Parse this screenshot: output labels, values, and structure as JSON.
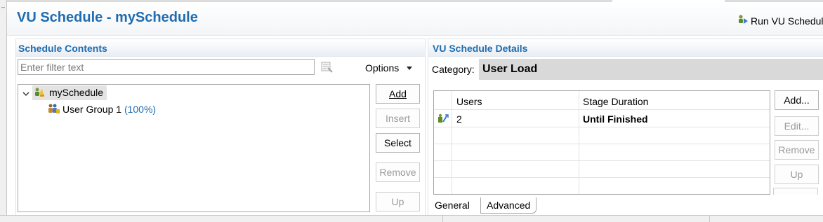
{
  "editor": {
    "title": "VU Schedule - mySchedule",
    "run_label": "Run VU Schedul"
  },
  "schedule_contents": {
    "header": "Schedule Contents",
    "filter_placeholder": "Enter filter text",
    "options_label": "Options",
    "tree": {
      "root_label": "mySchedule",
      "child_label": "User Group 1",
      "child_percent": "(100%)"
    },
    "buttons": {
      "add": "Add",
      "insert": "Insert",
      "select": "Select",
      "remove": "Remove",
      "up": "Up"
    }
  },
  "vu_details": {
    "header": "VU Schedule Details",
    "category_label": "Category:",
    "category_value": "User Load",
    "table": {
      "columns": [
        "Users",
        "Stage Duration"
      ],
      "rows": [
        {
          "users": "2",
          "stage_duration": "Until Finished"
        }
      ]
    },
    "buttons": {
      "add": "Add...",
      "edit": "Edit...",
      "remove": "Remove",
      "up": "Up"
    },
    "tabs": {
      "general": "General",
      "advanced": "Advanced"
    }
  },
  "colors": {
    "title_blue": "#1f6cb0",
    "percent_blue": "#1f6cb0",
    "category_bg": "#d9d9d9",
    "disabled_text": "#9a9a9a"
  }
}
